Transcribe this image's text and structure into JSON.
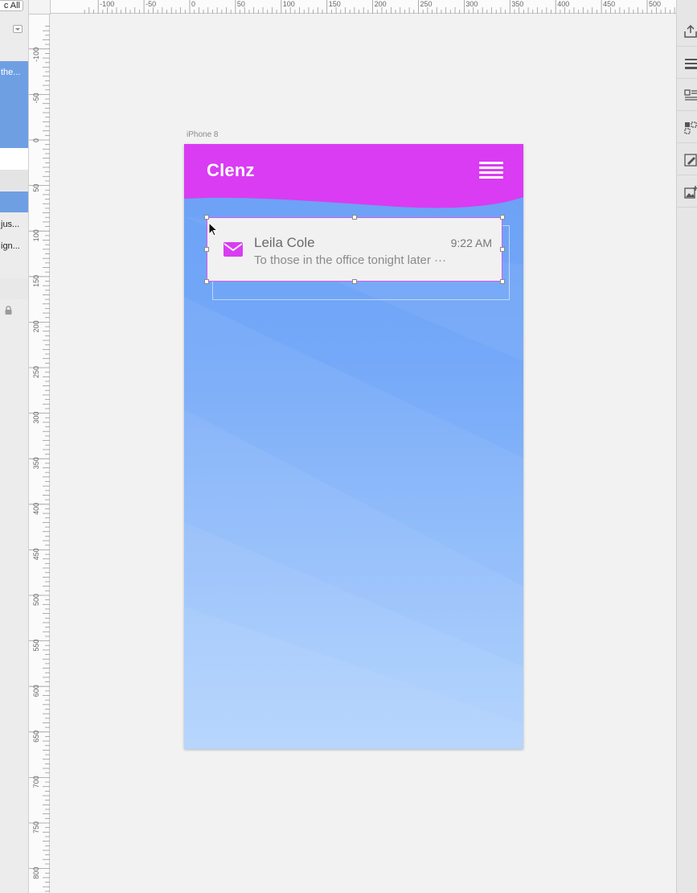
{
  "left_panel": {
    "top_button_label": "c All",
    "selected_group_label": "the...",
    "layer_item_4": "jus...",
    "layer_item_5": "ign..."
  },
  "ruler": {
    "top_labels": [
      "-100",
      "-50",
      "0",
      "50",
      "100",
      "150",
      "200",
      "250",
      "300",
      "350",
      "400",
      "450",
      "500"
    ],
    "left_labels": [
      "-100",
      "-50",
      "0",
      "50",
      "100",
      "150",
      "200",
      "250",
      "300",
      "350",
      "400",
      "450",
      "500",
      "550",
      "600",
      "650",
      "700",
      "750",
      "800"
    ]
  },
  "artboard": {
    "name": "iPhone 8"
  },
  "app": {
    "title": "Clenz",
    "header_color": "#d93cf3",
    "background_top": "#6fa4f6",
    "background_bottom": "#a3cbfd"
  },
  "notification": {
    "sender": "Leila Cole",
    "time": "9:22 AM",
    "preview": "To those in the office tonight later ···",
    "icon": "mail-icon",
    "accent_color": "#d93cf3"
  },
  "toolbar_icons": [
    "export-icon",
    "layers-icon",
    "list-icon",
    "components-icon",
    "edit-icon",
    "image-icon"
  ]
}
